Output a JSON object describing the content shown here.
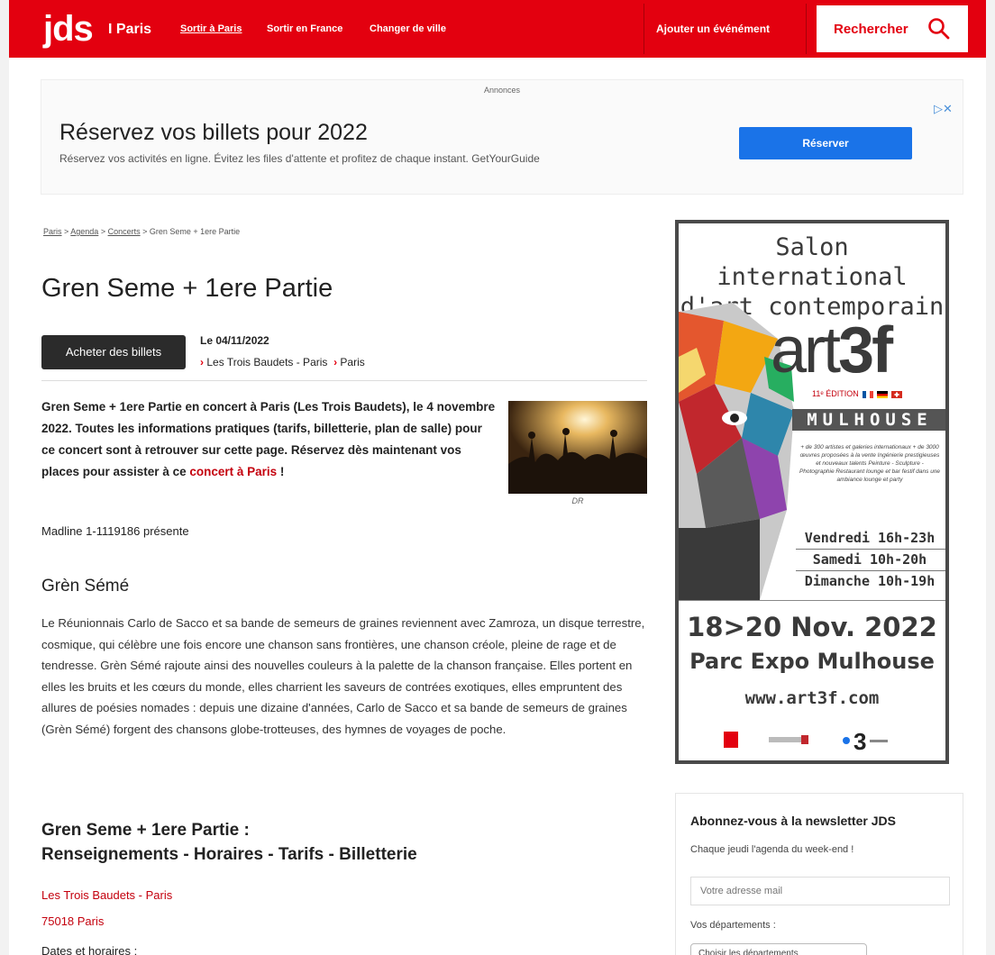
{
  "header": {
    "logo": "jds",
    "city": "I Paris",
    "nav": [
      "Sortir à Paris",
      "Sortir en France",
      "Changer de ville"
    ],
    "add_event": "Ajouter un événément",
    "search": "Rechercher"
  },
  "ad": {
    "label": "Annonces",
    "title": "Réservez vos billets pour 2022",
    "description": "Réservez vos activités en ligne. Évitez les files d'attente et profitez de chaque instant. GetYourGuide",
    "button": "Réserver",
    "icons": "▷✕"
  },
  "breadcrumb": {
    "items": [
      "Paris",
      "Agenda",
      "Concerts"
    ],
    "current": "Gren Seme + 1ere Partie",
    "sep": " > "
  },
  "event": {
    "title": "Gren Seme + 1ere Partie",
    "buy_button": "Acheter des billets",
    "date": "Le 04/11/2022",
    "venue": "Les Trois Baudets - Paris",
    "city": "Paris"
  },
  "intro": {
    "text": "Gren Seme + 1ere Partie en concert à Paris (Les Trois Baudets), le 4 novembre 2022. Toutes les informations pratiques (tarifs, billetterie, plan de salle) pour ce concert sont à retrouver sur cette page. Réservez dès maintenant vos places pour assister à ce ",
    "link": "concert à Paris",
    "end": " !",
    "photo_caption": "DR"
  },
  "presents": "Madline 1-1119186 présente",
  "section": {
    "subtitle": "Grèn Sémé",
    "body": "Le Réunionnais Carlo de Sacco et sa bande de semeurs de graines reviennent avec Zamroza, un disque terrestre, cosmique, qui célèbre une fois encore une chanson sans frontières, une chanson créole, pleine de rage et de tendresse. Grèn Sémé rajoute ainsi des nouvelles couleurs à la palette de la chanson française. Elles portent en elles les bruits et les cœurs du monde, elles charrient les saveurs de contrées exotiques, elles empruntent des allures de poésies nomades : depuis une dizaine d'années, Carlo de Sacco et sa bande de semeurs de graines (Grèn Sémé) forgent des chansons globe-trotteuses, des hymnes de voyages de poche."
  },
  "info": {
    "title_line1": "Gren Seme + 1ere Partie :",
    "title_line2": "Renseignements - Horaires - Tarifs - Billetterie",
    "venue": "Les Trois Baudets - Paris",
    "postal": "75018 Paris",
    "dates_label": "Dates et horaires :"
  },
  "poster": {
    "head_line1": "Salon international",
    "head_line2": "d'art contemporain",
    "art_light": "art",
    "art_bold": "3f",
    "edition": "11ᵉ ÉDITION",
    "mulhouse": "MULHOUSE",
    "small_text": "+ de 300 artistes et galeries internationaux + de 3000 œuvres proposées à la vente Ingénierie prestigieuses et nouveaux talents Peinture - Sculpture - Photographie Restaurant lounge et bar festif dans une ambiance lounge et party",
    "days": [
      "Vendredi 16h-23h",
      "Samedi 10h-20h",
      "Dimanche 10h-19h"
    ],
    "dates_line1": "18>20 Nov. 2022",
    "dates_line2": "Parc Expo Mulhouse",
    "url": "www.art3f.com"
  },
  "newsletter": {
    "title": "Abonnez-vous à la newsletter JDS",
    "subtitle": "Chaque jeudi l'agenda du week-end !",
    "placeholder": "Votre adresse mail",
    "departments_label": "Vos départements :",
    "select": "Choisir les départements"
  },
  "colors": {
    "brand_red": "#e3000f",
    "link_red": "#c4000d",
    "ad_blue": "#1a73e8"
  }
}
